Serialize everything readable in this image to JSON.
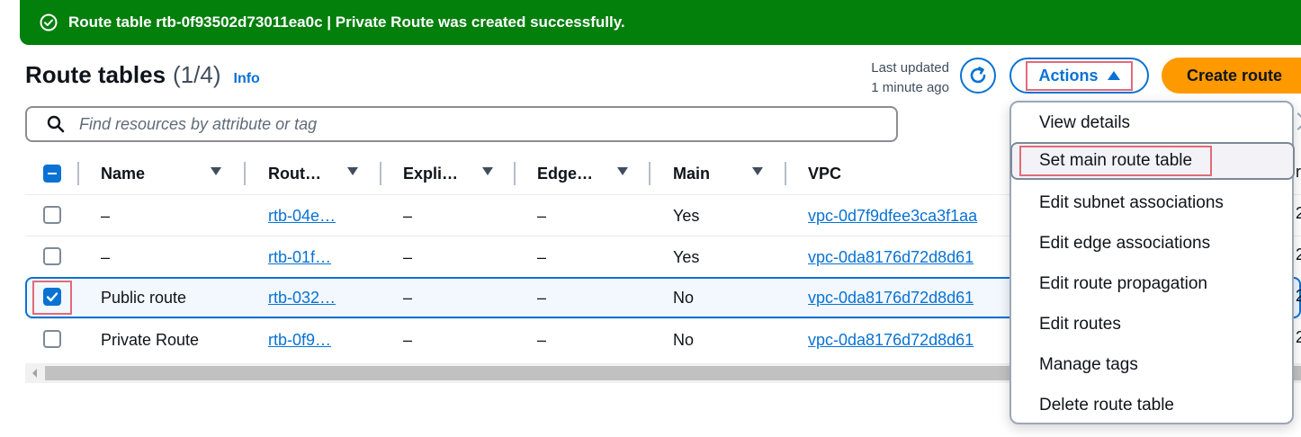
{
  "flash": {
    "message": "Route table rtb-0f93502d73011ea0c | Private Route was created successfully."
  },
  "header": {
    "title": "Route tables",
    "count": "(1/4)",
    "info": "Info",
    "last_updated_label": "Last updated",
    "last_updated_value": "1 minute ago",
    "actions_label": "Actions",
    "create_label": "Create route"
  },
  "search": {
    "placeholder": "Find resources by attribute or tag",
    "value": ""
  },
  "table": {
    "columns": [
      "Name",
      "Rout…",
      "Expli…",
      "Edge…",
      "Main",
      "VPC"
    ],
    "rows": [
      {
        "name": "–",
        "route_table_id": "rtb-04e…",
        "explicit": "–",
        "edge": "–",
        "main": "Yes",
        "vpc": "vpc-0d7f9dfee3ca3f1aa",
        "selected": false
      },
      {
        "name": "–",
        "route_table_id": "rtb-01f…",
        "explicit": "–",
        "edge": "–",
        "main": "Yes",
        "vpc": "vpc-0da8176d72d8d61",
        "selected": false
      },
      {
        "name": "Public route",
        "route_table_id": "rtb-032…",
        "explicit": "–",
        "edge": "–",
        "main": "No",
        "vpc": "vpc-0da8176d72d8d61",
        "selected": true
      },
      {
        "name": "Private Route",
        "route_table_id": "rtb-0f9…",
        "explicit": "–",
        "edge": "–",
        "main": "No",
        "vpc": "vpc-0da8176d72d8d61",
        "selected": false
      }
    ]
  },
  "actions_menu": {
    "items": [
      "View details",
      "Set main route table",
      "Edit subnet associations",
      "Edit edge associations",
      "Edit route propagation",
      "Edit routes",
      "Manage tags",
      "Delete route table"
    ],
    "hovered_index": 1
  },
  "colors": {
    "success": "#037f0c",
    "link": "#0972d3",
    "primary_button": "#ff9900",
    "highlight_outline": "#e26b77"
  },
  "icons": [
    "check-circle-icon",
    "refresh-icon",
    "caret-up-icon",
    "search-icon",
    "sort-icon"
  ]
}
